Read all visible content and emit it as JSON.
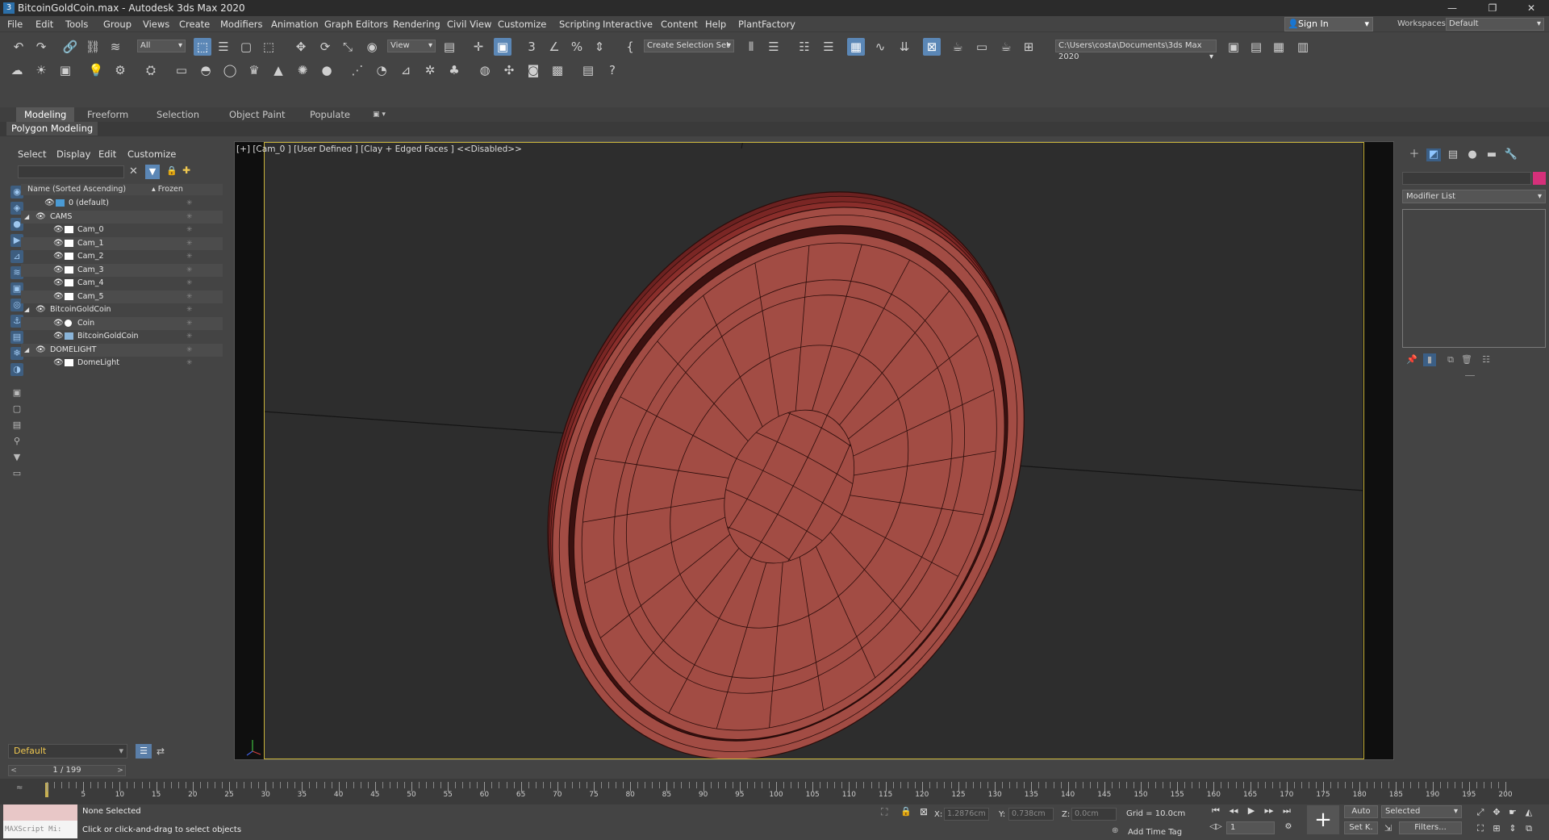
{
  "window": {
    "title": "BitcoinGoldCoin.max - Autodesk 3ds Max 2020",
    "app_icon": "3"
  },
  "menu": [
    "File",
    "Edit",
    "Tools",
    "Group",
    "Views",
    "Create",
    "Modifiers",
    "Animation",
    "Graph Editors",
    "Rendering",
    "Civil View",
    "Customize",
    "Scripting",
    "Interactive",
    "Content",
    "Help",
    "PlantFactory"
  ],
  "account": {
    "sign_in": "Sign In",
    "workspaces_label": "Workspaces:",
    "workspace": "Default"
  },
  "toolbar": {
    "selection_filter": "All",
    "ref_coord": "View",
    "selection_set": "Create Selection Set",
    "project_path": "C:\\Users\\costa\\Documents\\3ds Max 2020"
  },
  "ribbon": {
    "tabs": [
      "Modeling",
      "Freeform",
      "Selection",
      "Object Paint",
      "Populate"
    ],
    "active_tab": "Modeling",
    "subpanel": "Polygon Modeling"
  },
  "explorer": {
    "menu": [
      "Select",
      "Display",
      "Edit",
      "Customize"
    ],
    "col_name": "Name (Sorted Ascending)",
    "col_frozen": "▴ Frozen",
    "rows": [
      {
        "label": "0 (default)",
        "depth": 1,
        "type": "layer",
        "expand": false
      },
      {
        "label": "CAMS",
        "depth": 0,
        "type": "layer-group",
        "expand": true
      },
      {
        "label": "Cam_0",
        "depth": 2,
        "type": "camera",
        "expand": false
      },
      {
        "label": "Cam_1",
        "depth": 2,
        "type": "camera",
        "expand": false
      },
      {
        "label": "Cam_2",
        "depth": 2,
        "type": "camera",
        "expand": false
      },
      {
        "label": "Cam_3",
        "depth": 2,
        "type": "camera",
        "expand": false
      },
      {
        "label": "Cam_4",
        "depth": 2,
        "type": "camera",
        "expand": false
      },
      {
        "label": "Cam_5",
        "depth": 2,
        "type": "camera",
        "expand": false
      },
      {
        "label": "BitcoinGoldCoin",
        "depth": 0,
        "type": "layer-group",
        "expand": true
      },
      {
        "label": "Coin",
        "depth": 2,
        "type": "sphere",
        "expand": false
      },
      {
        "label": "BitcoinGoldCoin",
        "depth": 2,
        "type": "mesh",
        "expand": false
      },
      {
        "label": "DOMELIGHT",
        "depth": 0,
        "type": "layer-group",
        "expand": true
      },
      {
        "label": "DomeLight",
        "depth": 2,
        "type": "light",
        "expand": false
      }
    ],
    "layer": "Default"
  },
  "viewport": {
    "label": "[+] [Cam_0 ] [User Defined ] [Clay + Edged Faces ]  <<Disabled>>",
    "clay_color": "#a24c44",
    "wire_color": "#2a0c0a",
    "frame_color": "#c9b33a"
  },
  "command_panel": {
    "modifier_list": "Modifier List",
    "object_color": "#d6307a"
  },
  "timeline": {
    "frame": "1 / 199",
    "ticks": [
      5,
      10,
      15,
      20,
      25,
      30,
      35,
      40,
      45,
      50,
      55,
      60,
      65,
      70,
      75,
      80,
      85,
      90,
      95,
      100,
      105,
      110,
      115,
      120,
      125,
      130,
      135,
      140,
      145,
      150,
      155,
      160,
      165,
      170,
      175,
      180,
      185,
      190,
      195,
      200
    ]
  },
  "status": {
    "maxscript": "MAXScript Mi:",
    "selection": "None Selected",
    "prompt": "Click or click-and-drag to select objects",
    "x_label": "X:",
    "x_value": "1.2876cm",
    "y_label": "Y:",
    "y_value": "0.738cm",
    "z_label": "Z:",
    "z_value": "0.0cm",
    "grid": "Grid = 10.0cm",
    "add_time_tag": "Add Time Tag",
    "auto": "Auto",
    "set_key": "Set K.",
    "key_mode": "Selected",
    "filters": "Filters...",
    "frame_field": "1"
  }
}
